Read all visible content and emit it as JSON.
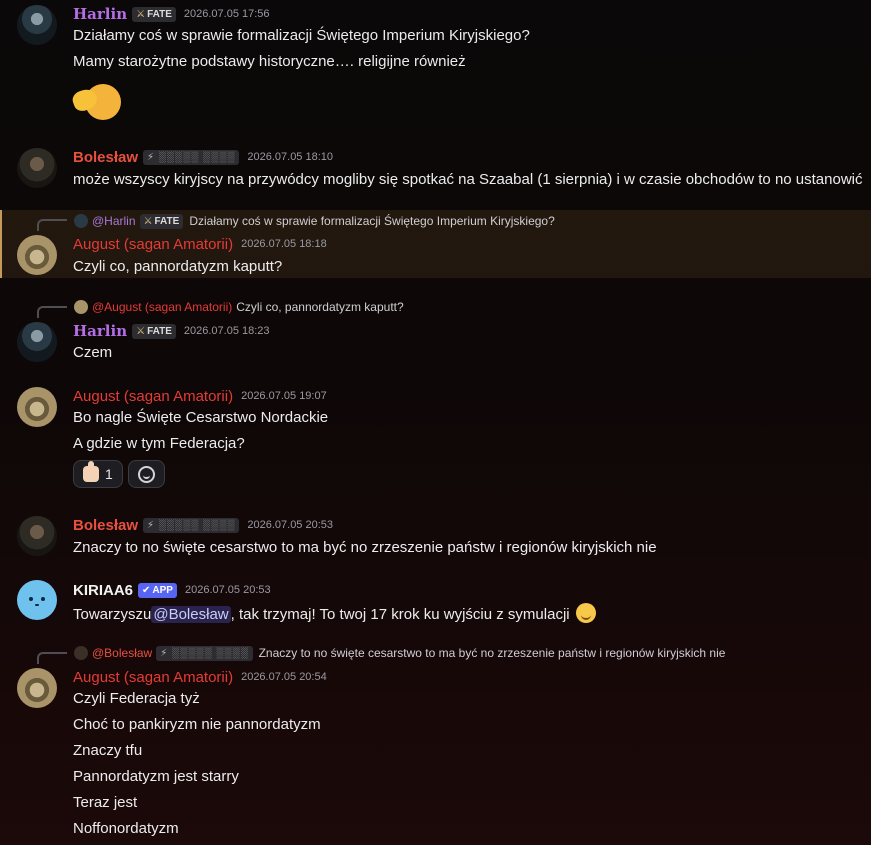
{
  "messages": [
    {
      "author": "Harlin",
      "badge": "FATE",
      "badge_icon": "sword-icon",
      "time": "2026.07.05 17:56",
      "lines": [
        "Działamy coś w sprawie formalizacji Świętego Imperium Kiryjskiego?",
        "Mamy starożytne podstawy historyczne…. religijne również"
      ],
      "attachment": "thumbs-up-face-emoji"
    },
    {
      "author": "Bolesław",
      "badge": "⚡ ░░░░░ ░░░░",
      "badge_icon": "lightning-icon",
      "time": "2026.07.05 18:10",
      "lines": [
        "może wszyscy kiryjscy na przywódcy mogliby się spotkać na Szaabal (1 sierpnia) i w czasie obchodów to no ustanowić"
      ]
    },
    {
      "author": "August (sagan Amatorii)",
      "time": "2026.07.05 18:18",
      "reply": {
        "author": "@Harlin",
        "badge": "FATE",
        "text": "Działamy coś w sprawie formalizacji Świętego Imperium Kiryjskiego?"
      },
      "lines": [
        "Czyli co, pannordatyzm kaputt?"
      ]
    },
    {
      "author": "Harlin",
      "badge": "FATE",
      "time": "2026.07.05 18:23",
      "reply": {
        "author": "@August (sagan Amatorii)",
        "text": "Czyli co, pannordatyzm kaputt?"
      },
      "lines": [
        "Czem"
      ]
    },
    {
      "author": "August (sagan Amatorii)",
      "time": "2026.07.05 19:07",
      "lines": [
        "Bo nagle Święte Cesarstwo Nordackie",
        "A gdzie w tym Federacja?"
      ],
      "reactions": [
        {
          "emoji": "thumbs-up-icon",
          "count": "1"
        },
        {
          "emoji": "add-reaction-icon",
          "count": ""
        }
      ]
    },
    {
      "author": "Bolesław",
      "badge": "⚡ ░░░░░ ░░░░",
      "time": "2026.07.05 20:53",
      "lines": [
        "Znaczy to no święte cesarstwo to ma być no zrzeszenie państw i regionów kiryjskich nie"
      ]
    },
    {
      "author": "KIRIAA6",
      "badge": "APP",
      "badge_icon": "check-icon",
      "time": "2026.07.05 20:53",
      "text_before": "Towarzyszu",
      "mention": "@Bolesław",
      "text_after": ", tak trzymaj! To twoj 17 krok ku wyjściu z symulacji"
    },
    {
      "author": "August (sagan Amatorii)",
      "time": "2026.07.05 20:54",
      "reply": {
        "author": "@Bolesław",
        "badge": "⚡ ░░░░░ ░░░░",
        "text": "Znaczy to no święte cesarstwo to ma być no zrzeszenie państw i regionów kiryjskich nie"
      },
      "lines": [
        "Czyli Federacja tyż",
        "Choć to pankiryzm nie pannordatyzm",
        "Znaczy tfu",
        "Pannordatyzm jest starry",
        "Teraz jest",
        "Noffonordatyzm"
      ]
    }
  ]
}
